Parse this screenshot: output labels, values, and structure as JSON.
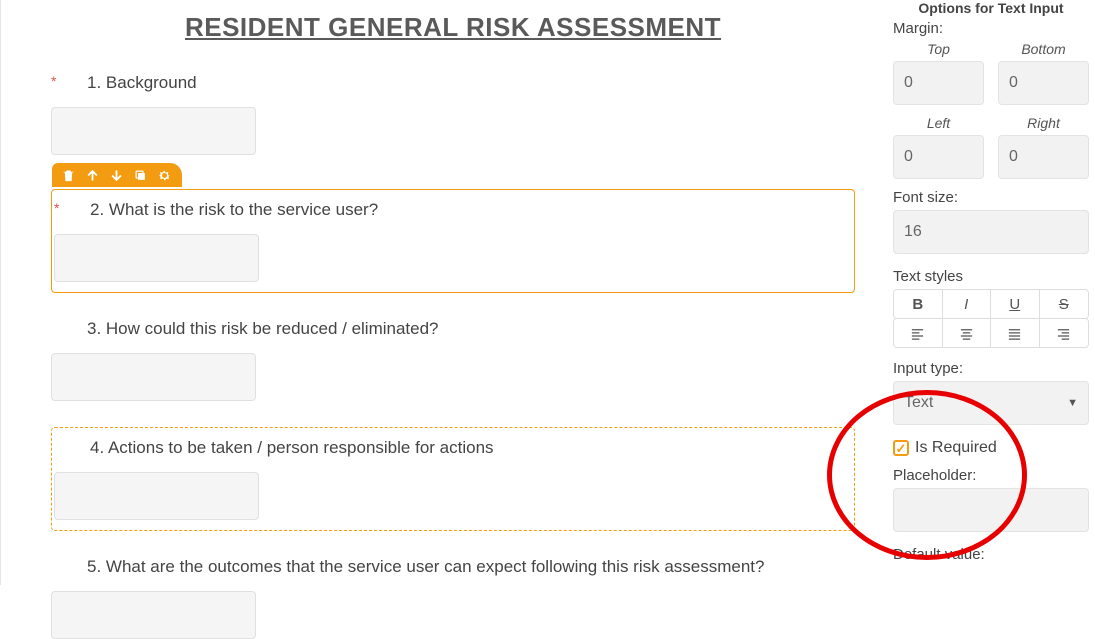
{
  "form": {
    "title": "RESIDENT GENERAL RISK ASSESSMENT",
    "questions": [
      {
        "required": true,
        "text": "1. Background"
      },
      {
        "required": true,
        "text": "2. What is the risk to the service user?"
      },
      {
        "required": false,
        "text": "3. How could this risk be reduced / eliminated?"
      },
      {
        "required": false,
        "text": "4.  Actions to be taken / person responsible for actions"
      },
      {
        "required": false,
        "text": "5. What are the outcomes that the service user can expect following this risk assessment?"
      }
    ],
    "required_mark": "*"
  },
  "toolbar": {
    "icons": [
      "trash-icon",
      "arrow-up-icon",
      "arrow-down-icon",
      "copy-icon",
      "gear-icon"
    ]
  },
  "panel": {
    "title": "Options for Text Input",
    "margin_label": "Margin:",
    "margin": {
      "top_label": "Top",
      "top_value": "0",
      "bottom_label": "Bottom",
      "bottom_value": "0",
      "left_label": "Left",
      "left_value": "0",
      "right_label": "Right",
      "right_value": "0"
    },
    "font_size_label": "Font size:",
    "font_size_value": "16",
    "text_styles_label": "Text styles",
    "input_type_label": "Input type:",
    "input_type_value": "Text",
    "is_required_label": "Is Required",
    "is_required_checked": true,
    "placeholder_label": "Placeholder:",
    "placeholder_value": "",
    "default_value_label": "Default value:"
  }
}
